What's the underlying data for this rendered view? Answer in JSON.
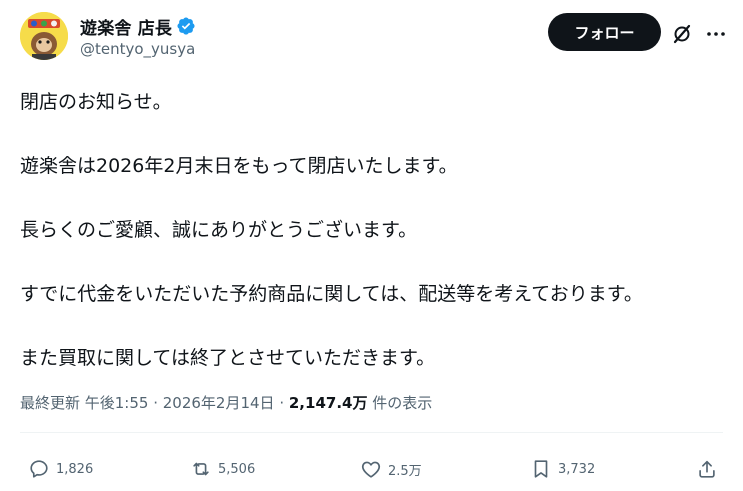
{
  "author": {
    "display_name": "遊楽舎 店長",
    "handle": "@tentyo_yusya"
  },
  "header": {
    "follow_label": "フォロー",
    "more_label": "···"
  },
  "tweet": {
    "paragraphs": [
      "閉店のお知らせ。",
      "遊楽舎は2026年2月末日をもって閉店いたします。",
      "長らくのご愛顧、誠にありがとうございます。",
      "すでに代金をいただいた予約商品に関しては、配送等を考えております。",
      "また買取に関しては終了とさせていただきます。"
    ]
  },
  "meta": {
    "edited_time": "最終更新 午後1:55 · 2026年2月14日 · ",
    "views_count": "2,147.4万",
    "views_label": " 件の表示"
  },
  "actions": {
    "replies": "1,826",
    "reposts": "5,506",
    "likes": "2.5万",
    "bookmarks": "3,732"
  },
  "colors": {
    "text": "#0f1419",
    "secondary": "#536471",
    "verified": "#1d9bf0",
    "follow_bg": "#0f1419"
  }
}
